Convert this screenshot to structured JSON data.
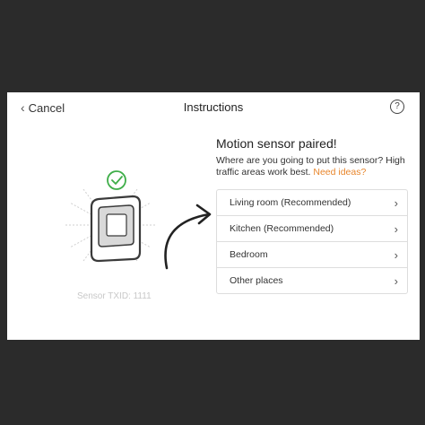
{
  "header": {
    "cancel_label": "Cancel",
    "cancel_icon": "chevron-left-icon",
    "title": "Instructions",
    "help_label": "?"
  },
  "sensor": {
    "txid_label": "Sensor TXID: 1111",
    "status_icon": "check-circle-icon",
    "check_color": "#3fae49"
  },
  "main": {
    "heading": "Motion sensor paired!",
    "description": "Where are you going to put this sensor? High traffic areas work best.",
    "link_text": "Need ideas?",
    "link_color": "#e8862c",
    "locations": [
      {
        "label": "Living room (Recommended)"
      },
      {
        "label": "Kitchen (Recommended)"
      },
      {
        "label": "Bedroom"
      },
      {
        "label": "Other places"
      }
    ],
    "row_icon": "chevron-right-icon"
  }
}
